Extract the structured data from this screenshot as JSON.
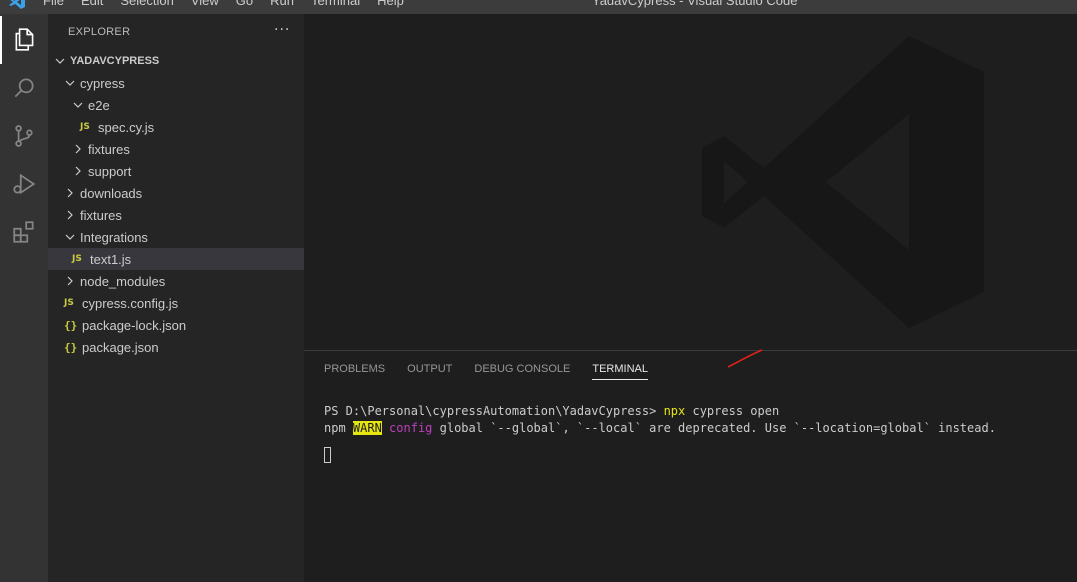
{
  "titlebar": {
    "menu": [
      "File",
      "Edit",
      "Selection",
      "View",
      "Go",
      "Run",
      "Terminal",
      "Help"
    ],
    "window_title": "YadavCypress - Visual Studio Code"
  },
  "activity_bar": {
    "items": [
      "explorer-icon",
      "search-icon",
      "source-control-icon",
      "run-debug-icon",
      "extensions-icon"
    ]
  },
  "explorer": {
    "header": "EXPLORER",
    "more": "···",
    "root": "YADAVCYPRESS",
    "items": [
      {
        "label": "cypress"
      },
      {
        "label": "e2e"
      },
      {
        "label": "spec.cy.js",
        "icon": "JS"
      },
      {
        "label": "fixtures"
      },
      {
        "label": "support"
      },
      {
        "label": "downloads"
      },
      {
        "label": "fixtures"
      },
      {
        "label": "Integrations"
      },
      {
        "label": "text1.js",
        "icon": "JS"
      },
      {
        "label": "node_modules"
      },
      {
        "label": "cypress.config.js",
        "icon": "JS"
      },
      {
        "label": "package-lock.json",
        "icon": "{}"
      },
      {
        "label": "package.json",
        "icon": "{}"
      }
    ]
  },
  "panel": {
    "tabs": [
      "PROBLEMS",
      "OUTPUT",
      "DEBUG CONSOLE",
      "TERMINAL"
    ],
    "active_tab": "TERMINAL",
    "terminal": {
      "prompt": "PS D:\\Personal\\cypressAutomation\\YadavCypress> ",
      "command": "npx",
      "command_args": " cypress open",
      "warn_prefix": "npm ",
      "warn_tag": "WARN",
      "warn_config": "config",
      "warn_message": " global `--global`, `--local` are deprecated. Use `--location=global` instead."
    }
  },
  "colors": {
    "accent_yellow": "#e5e510",
    "magenta": "#bc3fbc",
    "sidebar_bg": "#252526",
    "editor_bg": "#1e1e1e"
  }
}
